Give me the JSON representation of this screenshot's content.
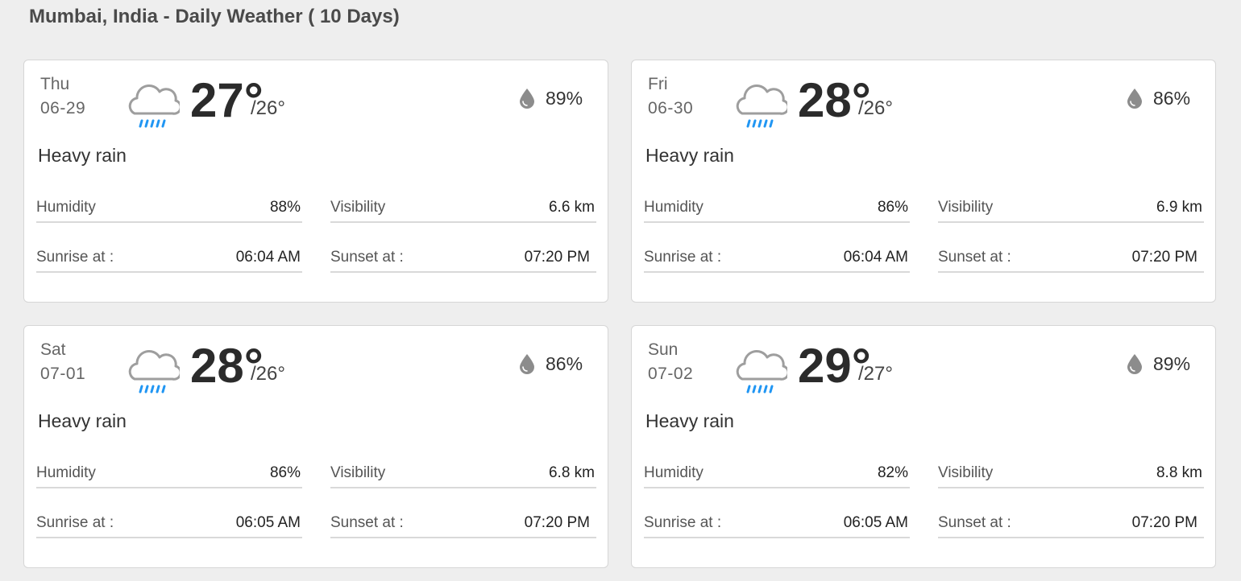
{
  "page": {
    "title": "Mumbai, India - Daily Weather ( 10 Days)"
  },
  "labels": {
    "humidity": "Humidity",
    "visibility": "Visibility",
    "sunrise": "Sunrise at :",
    "sunset": "Sunset at :"
  },
  "icons": {
    "weather": "heavy-rain-cloud-icon",
    "precip": "water-drop-icon"
  },
  "colors": {
    "rain_accent": "#2196f3",
    "cloud": "#9e9e9e",
    "drop": "#8c8c8c"
  },
  "days": [
    {
      "day": "Thu",
      "date": "06-29",
      "high": "27°",
      "low": "/26°",
      "precip": "89%",
      "condition": "Heavy rain",
      "humidity": "88%",
      "visibility": "6.6 km",
      "sunrise": "06:04 AM",
      "sunset": "07:20 PM"
    },
    {
      "day": "Fri",
      "date": "06-30",
      "high": "28°",
      "low": "/26°",
      "precip": "86%",
      "condition": "Heavy rain",
      "humidity": "86%",
      "visibility": "6.9 km",
      "sunrise": "06:04 AM",
      "sunset": "07:20 PM"
    },
    {
      "day": "Sat",
      "date": "07-01",
      "high": "28°",
      "low": "/26°",
      "precip": "86%",
      "condition": "Heavy rain",
      "humidity": "86%",
      "visibility": "6.8 km",
      "sunrise": "06:05 AM",
      "sunset": "07:20 PM"
    },
    {
      "day": "Sun",
      "date": "07-02",
      "high": "29°",
      "low": "/27°",
      "precip": "89%",
      "condition": "Heavy rain",
      "humidity": "82%",
      "visibility": "8.8 km",
      "sunrise": "06:05 AM",
      "sunset": "07:20 PM"
    }
  ]
}
